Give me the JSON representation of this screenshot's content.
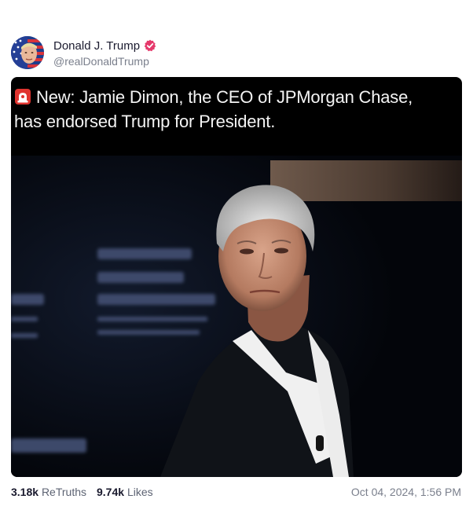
{
  "author": {
    "display_name": "Donald J. Trump",
    "handle": "@realDonaldTrump"
  },
  "post": {
    "headline_line1": "New: Jamie Dimon, the CEO of JPMorgan Chase,",
    "headline_line2": "has endorsed Trump for President."
  },
  "stats": {
    "retruths_count": "3.18k",
    "retruths_label": "ReTruths",
    "likes_count": "9.74k",
    "likes_label": "Likes"
  },
  "timestamp": "Oct 04, 2024, 1:56 PM",
  "colors": {
    "verified_badge": "#e5396b",
    "siren": "#e0342f",
    "media_background": "#000000"
  },
  "icons": {
    "verified": "verified-badge-icon",
    "siren": "siren-emoji-icon"
  }
}
